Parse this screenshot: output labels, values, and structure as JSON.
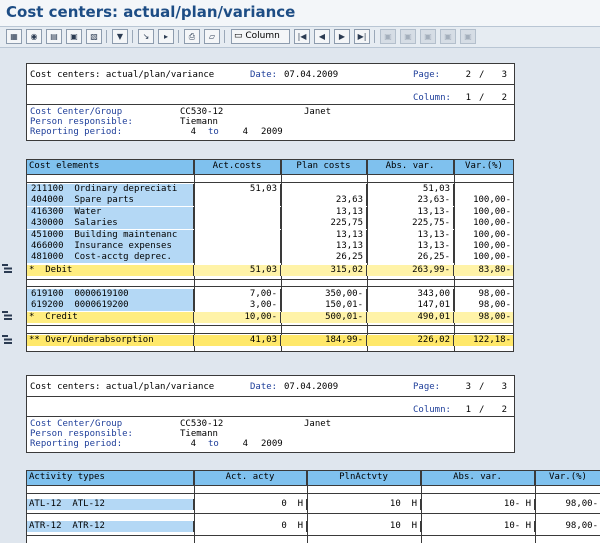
{
  "window": {
    "title": "Cost centers: actual/plan/variance"
  },
  "toolbar": {
    "column_label": "Column"
  },
  "report1": {
    "header": {
      "title": "Cost centers: actual/plan/variance",
      "date_label": "Date:",
      "date": "07.04.2009",
      "page_label": "Page:",
      "page_current": "2",
      "page_sep": "/",
      "page_total": "3",
      "column_label": "Column:",
      "column_current": "1",
      "column_sep": "/",
      "column_total": "2",
      "cc_group_label": "Cost Center/Group",
      "cc_group_value": "CC530-12",
      "cc_group_name": "Janet",
      "person_label": "Person responsible:",
      "person_value": "Tiemann",
      "period_label": "Reporting period:",
      "period_from": "4",
      "period_to_label": "to",
      "period_to": "4",
      "period_year": "2009"
    },
    "table": {
      "columns": [
        "Cost elements",
        "Act.costs",
        "Plan costs",
        "Abs. var.",
        "Var.(%)"
      ],
      "debit_rows": [
        {
          "element": "211100  Ordinary depreciati",
          "act": "51,03",
          "plan": "",
          "abs": "51,03",
          "var": ""
        },
        {
          "element": "404000  Spare parts",
          "act": "",
          "plan": "23,63",
          "abs": "23,63-",
          "var": "100,00-"
        },
        {
          "element": "416300  Water",
          "act": "",
          "plan": "13,13",
          "abs": "13,13-",
          "var": "100,00-"
        },
        {
          "element": "430000  Salaries",
          "act": "",
          "plan": "225,75",
          "abs": "225,75-",
          "var": "100,00-"
        },
        {
          "element": "451000  Building maintenanc",
          "act": "",
          "plan": "13,13",
          "abs": "13,13-",
          "var": "100,00-"
        },
        {
          "element": "466000  Insurance expenses",
          "act": "",
          "plan": "13,13",
          "abs": "13,13-",
          "var": "100,00-"
        },
        {
          "element": "481000  Cost-acctg deprec.",
          "act": "",
          "plan": "26,25",
          "abs": "26,25-",
          "var": "100,00-"
        }
      ],
      "debit_total": {
        "element": "*  Debit",
        "act": "51,03",
        "plan": "315,02",
        "abs": "263,99-",
        "var": "83,80-"
      },
      "credit_rows": [
        {
          "element": "619100  0000619100",
          "act": "7,00-",
          "plan": "350,00-",
          "abs": "343,00",
          "var": "98,00-"
        },
        {
          "element": "619200  0000619200",
          "act": "3,00-",
          "plan": "150,01-",
          "abs": "147,01",
          "var": "98,00-"
        }
      ],
      "credit_total": {
        "element": "*  Credit",
        "act": "10,00-",
        "plan": "500,01-",
        "abs": "490,01",
        "var": "98,00-"
      },
      "grand_total": {
        "element": "** Over/underabsorption",
        "act": "41,03",
        "plan": "184,99-",
        "abs": "226,02",
        "var": "122,18-"
      }
    }
  },
  "report2": {
    "header": {
      "title": "Cost centers: actual/plan/variance",
      "date_label": "Date:",
      "date": "07.04.2009",
      "page_label": "Page:",
      "page_current": "3",
      "page_sep": "/",
      "page_total": "3",
      "column_label": "Column:",
      "column_current": "1",
      "column_sep": "/",
      "column_total": "2",
      "cc_group_label": "Cost Center/Group",
      "cc_group_value": "CC530-12",
      "cc_group_name": "Janet",
      "person_label": "Person responsible:",
      "person_value": "Tiemann",
      "period_label": "Reporting period:",
      "period_from": "4",
      "period_to_label": "to",
      "period_to": "4",
      "period_year": "2009"
    },
    "table": {
      "columns": [
        "Activity types",
        "Act. acty",
        "PlnActvty",
        "Abs. var.",
        "Var.(%)"
      ],
      "rows": [
        {
          "element": "ATL-12  ATL-12",
          "act": "0  H",
          "plan": "10  H",
          "abs": "10- H",
          "var": "98,00-"
        },
        {
          "element": "ATR-12  ATR-12",
          "act": "0  H",
          "plan": "10  H",
          "abs": "10- H",
          "var": "98,00-"
        }
      ]
    }
  }
}
